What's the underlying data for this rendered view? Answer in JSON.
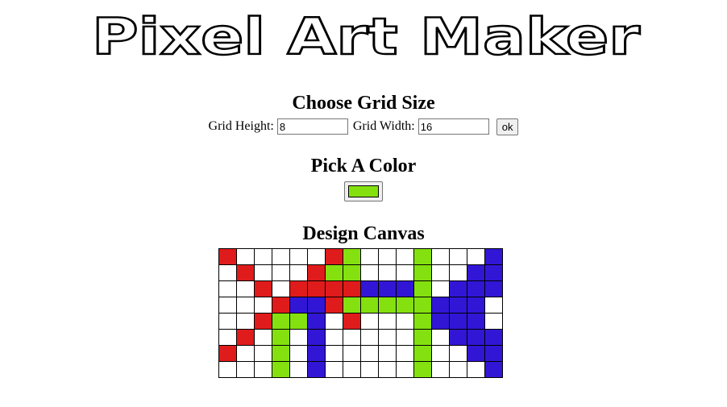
{
  "app": {
    "title": "Pixel Art Maker"
  },
  "grid_size": {
    "title": "Choose Grid Size",
    "height_label": "Grid Height:",
    "height_value": "8",
    "width_label": "Grid Width:",
    "width_value": "16",
    "submit_label": "ok"
  },
  "color": {
    "title": "Pick A Color",
    "selected": "#84e10f"
  },
  "canvas": {
    "title": "Design Canvas",
    "palette": {
      "W": "#ffffff",
      "R": "#e01b1b",
      "G": "#84e10f",
      "B": "#3216d6"
    },
    "rows": [
      "RWWWWWRGWWWGWWWB",
      "WRWWWRGGWWWGWWBB",
      "WWRWRRRRBBBGWBBB",
      "WWWRBBRGGGGGBBBW",
      "WWRGGBWRWWWGBBBW",
      "WRWGWBWWWWWGWBBB",
      "RWWGWBWWWWWGWWBB",
      "WWWGWBWWWWWGWWWB"
    ]
  }
}
